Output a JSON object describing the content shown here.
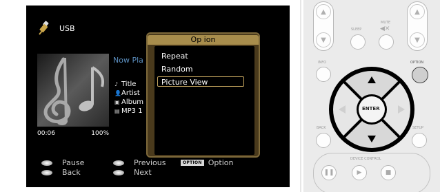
{
  "screen": {
    "source": "USB",
    "now_playing": "Now Pla",
    "track": {
      "title": "Title",
      "artist": "Artist",
      "album": "Album",
      "format": "MP3 1"
    },
    "time_elapsed": "00:06",
    "progress_label": "100%",
    "option_menu": {
      "title": "Op ion",
      "items": [
        "Repeat",
        "Random",
        "Picture View"
      ],
      "selected_index": 2
    },
    "hints": {
      "pause": "Pause",
      "back": "Back",
      "previous": "Previous",
      "next": "Next",
      "option_badge": "OPTION",
      "option": "Option"
    }
  },
  "remote": {
    "labels": {
      "sleep": "SLEEP",
      "mute": "MUTE",
      "info": "INFO",
      "option": "OPTION",
      "enter": "ENTER",
      "back": "BACK",
      "setup": "SETUP",
      "device_control": "DEVICE CONTROL"
    }
  },
  "colors": {
    "popup_title_bar": "#a88d4c",
    "popup_border": "#7f6a3b",
    "now_playing_text": "#5b8fc0",
    "remote_ring": "#000000"
  }
}
